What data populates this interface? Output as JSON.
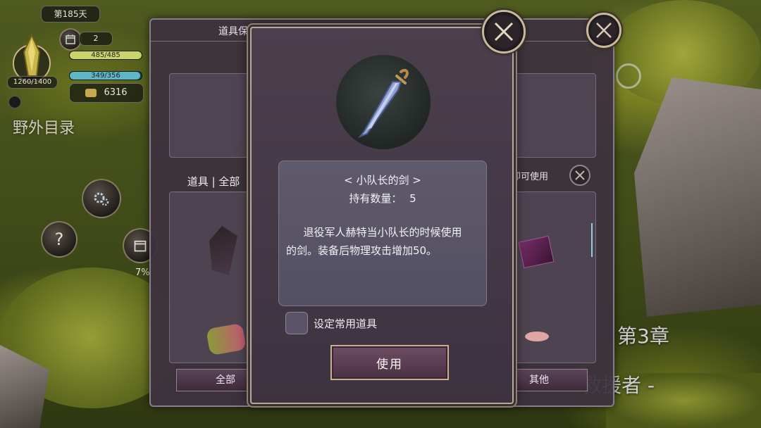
{
  "hud": {
    "day": "第185天",
    "calendar_count": "2",
    "hp": "485/485",
    "hp_fraction": 1.0,
    "mp": "349/356",
    "mp_fraction": 0.98,
    "crystal": "1260/1400",
    "gold": "6316",
    "field_list": "野外目录",
    "percent": "7%",
    "help": "?"
  },
  "back_panel": {
    "title": "道具保管箱",
    "filter_label": "道具 | 全部",
    "use_hint": "即可使用",
    "tab_all": "全部",
    "tab_other": "其他"
  },
  "item_dialog": {
    "item_name": "< 小队长的剑 >",
    "quantity_label": "持有数量：",
    "quantity": "5",
    "description_line1": "退役军人赫特当小队长的时候使用",
    "description_line2": "的剑。装备后物理攻击增加50。",
    "favorite_label": "设定常用道具",
    "favorite_checked": false,
    "use_button": "使用"
  },
  "scene": {
    "chapter": "第3章",
    "subtitle": "救援者 -"
  },
  "colors": {
    "hp_bar": "#c9d46a",
    "mp_bar": "#5fb6c6",
    "dialog_border": "#b9aa98",
    "button": "#6d4d63"
  }
}
